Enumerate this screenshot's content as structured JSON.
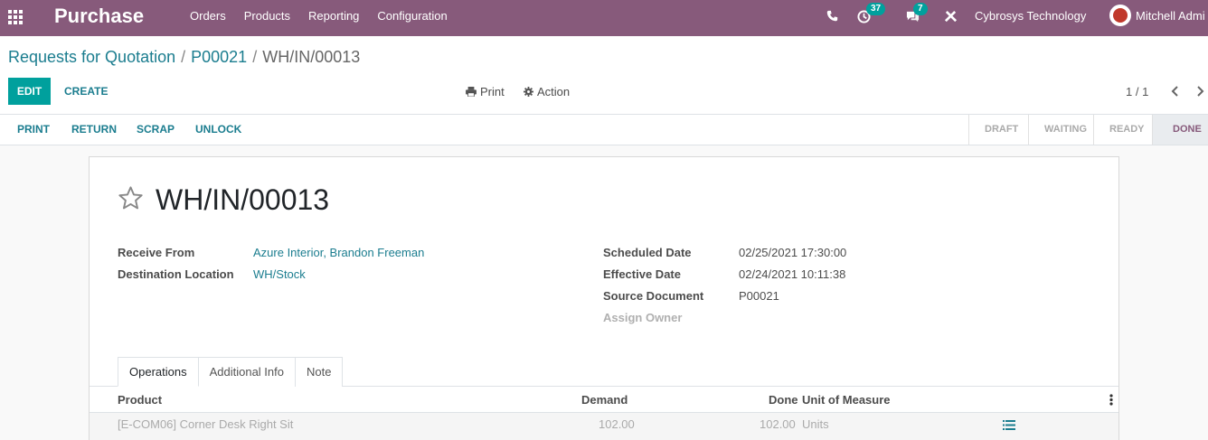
{
  "navbar": {
    "brand": "Purchase",
    "menu": [
      "Orders",
      "Products",
      "Reporting",
      "Configuration"
    ],
    "activity_count": "37",
    "message_count": "7",
    "company": "Cybrosys Technology",
    "user": "Mitchell Admi"
  },
  "breadcrumb": [
    "Requests for Quotation",
    "P00021",
    "WH/IN/00013"
  ],
  "buttons": {
    "edit": "EDIT",
    "create": "CREATE",
    "print": "Print",
    "action": "Action"
  },
  "pager": "1 / 1",
  "header_actions": [
    "PRINT",
    "RETURN",
    "SCRAP",
    "UNLOCK"
  ],
  "stages": [
    "DRAFT",
    "WAITING",
    "READY",
    "DONE"
  ],
  "active_stage": "DONE",
  "record": {
    "name": "WH/IN/00013",
    "left_fields": [
      {
        "label": "Receive From",
        "value": "Azure Interior, Brandon Freeman"
      },
      {
        "label": "Destination Location",
        "value": "WH/Stock"
      }
    ],
    "right_fields": [
      {
        "label": "Scheduled Date",
        "value": "02/25/2021 17:30:00"
      },
      {
        "label": "Effective Date",
        "value": "02/24/2021 10:11:38"
      },
      {
        "label": "Source Document",
        "value": "P00021"
      },
      {
        "label": "Assign Owner",
        "value": ""
      }
    ]
  },
  "tabs": [
    "Operations",
    "Additional Info",
    "Note"
  ],
  "table": {
    "headers": [
      "Product",
      "Demand",
      "Done",
      "Unit of Measure"
    ],
    "rows": [
      {
        "product": "[E-COM06] Corner Desk Right Sit",
        "demand": "102.00",
        "done": "102.00",
        "uom": "Units"
      }
    ]
  },
  "colors": {
    "navbar": "#875a7b",
    "primary": "#00a09d",
    "link": "#1b7d8f"
  },
  "icons": [
    "apps-grid-icon",
    "phone-icon",
    "clock-icon",
    "chat-icon",
    "tools-icon",
    "printer-icon",
    "gear-icon",
    "chevron-left-icon",
    "chevron-right-icon",
    "star-icon",
    "kebab-icon",
    "list-detail-icon"
  ]
}
